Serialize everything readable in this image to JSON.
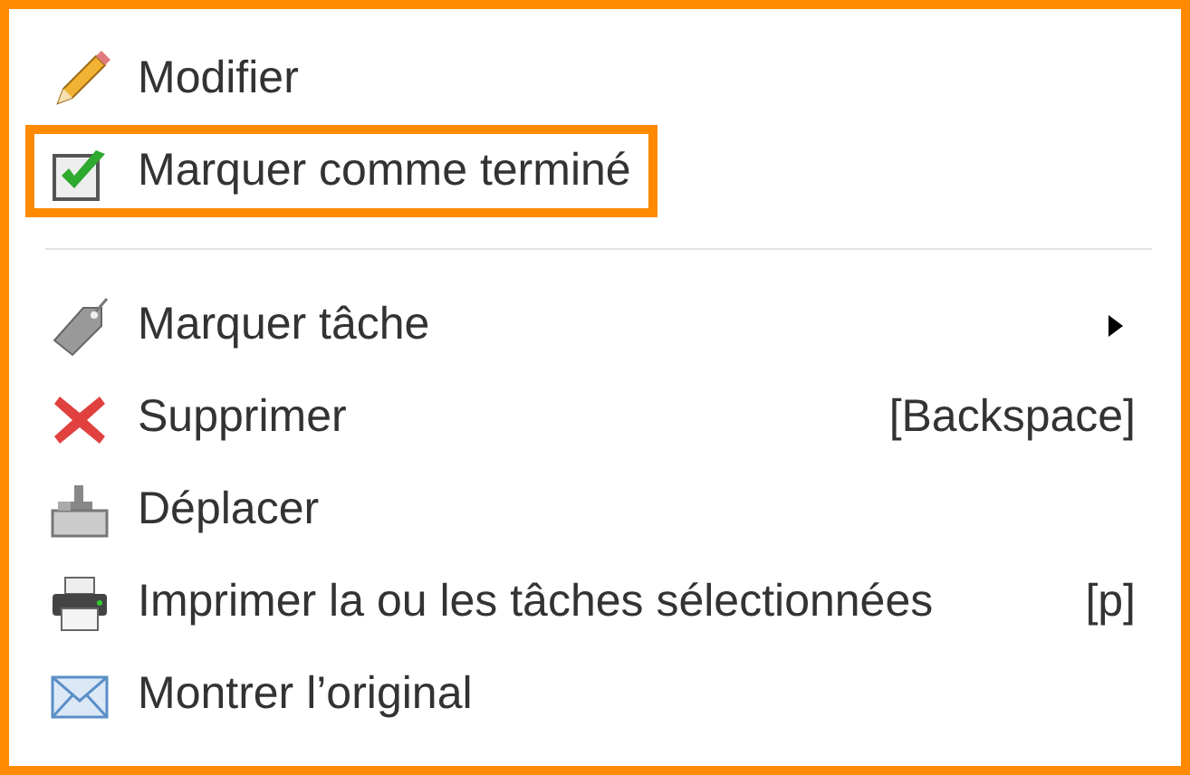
{
  "menu": {
    "items": [
      {
        "kind": "item",
        "label": "Modifier",
        "highlighted": false
      },
      {
        "kind": "item",
        "label": "Marquer comme terminé",
        "highlighted": true
      },
      {
        "kind": "separator"
      },
      {
        "kind": "item",
        "label": "Marquer tâche",
        "highlighted": false,
        "submenu": true
      },
      {
        "kind": "item",
        "label": "Supprimer",
        "highlighted": false,
        "shortcut": "[Backspace]"
      },
      {
        "kind": "item",
        "label": "Déplacer",
        "highlighted": false
      },
      {
        "kind": "item",
        "label": "Imprimer la ou les tâches sélectionnées",
        "highlighted": false,
        "shortcut": "[p]"
      },
      {
        "kind": "item",
        "label": "Montrer l’original",
        "highlighted": false
      }
    ]
  }
}
